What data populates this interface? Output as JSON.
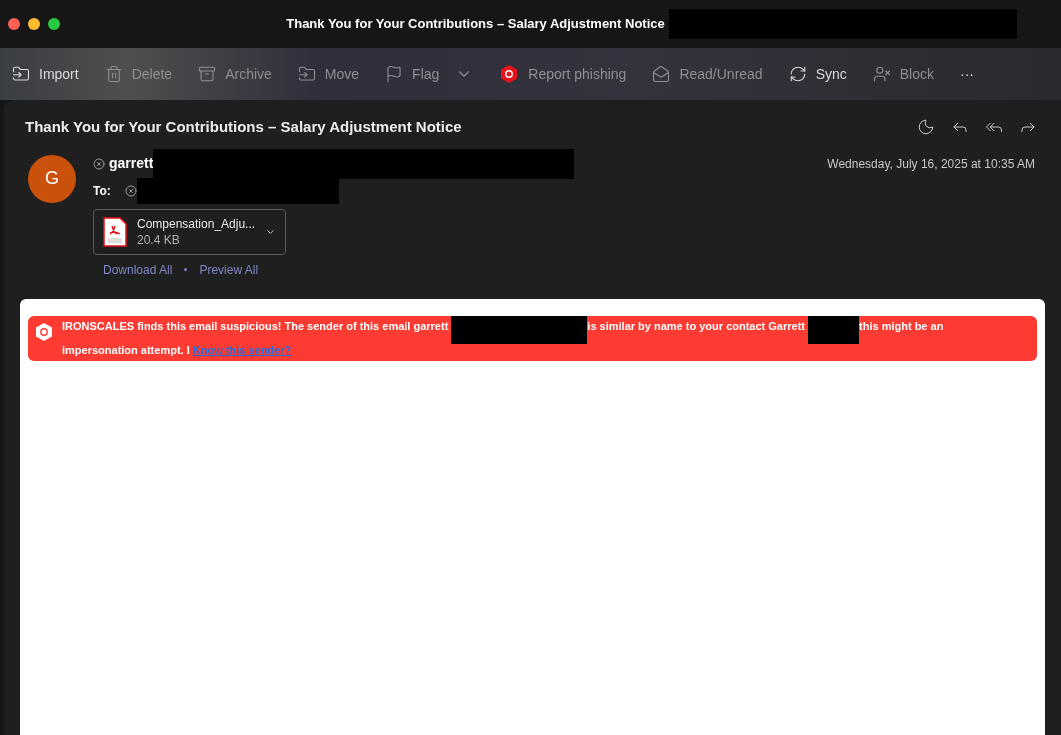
{
  "window": {
    "title": "Thank You for Your Contributions – Salary Adjustment Notice"
  },
  "toolbar": [
    {
      "kind": "import",
      "label": "Import",
      "disabled": false
    },
    {
      "kind": "delete",
      "label": "Delete",
      "disabled": true
    },
    {
      "kind": "archive",
      "label": "Archive",
      "disabled": true
    },
    {
      "kind": "move",
      "label": "Move",
      "disabled": true
    },
    {
      "kind": "flag",
      "label": "Flag",
      "disabled": true
    },
    {
      "kind": "phishing",
      "label": "Report phishing",
      "disabled": true
    },
    {
      "kind": "readunread",
      "label": "Read/Unread",
      "disabled": true
    },
    {
      "kind": "sync",
      "label": "Sync",
      "disabled": false
    },
    {
      "kind": "block",
      "label": "Block",
      "disabled": true
    },
    {
      "kind": "more",
      "label": "···",
      "disabled": false
    }
  ],
  "message": {
    "subject": "Thank You for Your Contributions – Salary Adjustment Notice",
    "avatar": "G",
    "sender": "garrett",
    "to_label": "To:",
    "date": "Wednesday, July 16, 2025 at 10:35 AM",
    "attachment": {
      "name": "Compensation_Adju...",
      "size": "20.4 KB"
    },
    "links": [
      "Download All",
      "Preview All"
    ],
    "banner": {
      "parts": [
        "IRONSCALES finds this email suspicious! The sender of this email garrett",
        "is similar by name to your contact Garrett",
        "this might be an impersonation attempt. I"
      ],
      "link": "Know this sender?"
    }
  }
}
